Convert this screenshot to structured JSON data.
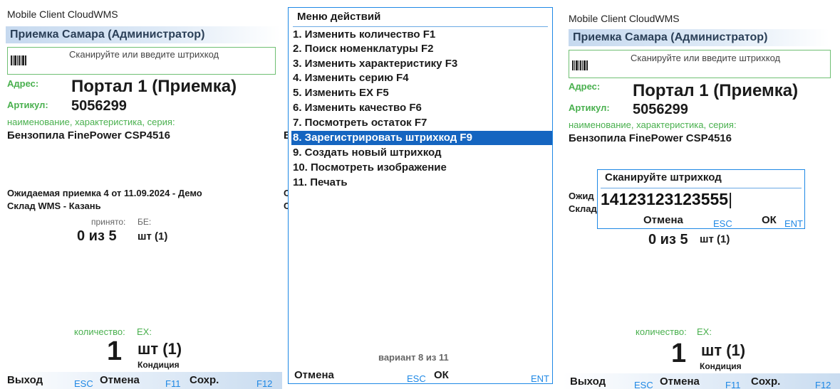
{
  "panel1": {
    "window_title": "Mobile Client CloudWMS",
    "header": "Приемка Самара (Администратор)",
    "scan_placeholder": "Сканируйте или введите штрихкод",
    "address_label": "Адрес:",
    "address_value": "Портал 1 (Приемка)",
    "article_label": "Артикул:",
    "article_value": "5056299",
    "fields_hint": "наименование,  характеристика,  серия:",
    "product_name": "Бензопила FinePower CSP4516",
    "expected_line1": "Ожидаемая приемка 4 от 11.09.2024 - Демо",
    "expected_line2": "Склад WMS - Казань",
    "accepted_label": "принято:",
    "be_label": "БЕ:",
    "accepted_value": "0 из 5",
    "unit": "шт (1)",
    "qty_label": "количество:",
    "ex_label": "ЕХ:",
    "qty_value": "1",
    "qty_unit": "шт (1)",
    "condition": "Кондиция",
    "footer": {
      "exit": "Выход",
      "exit_key": "ESC",
      "cancel": "Отмена",
      "cancel_key": "F11",
      "save": "Сохр.",
      "save_key": "F12"
    }
  },
  "panel2": {
    "menu_title": "Меню действий",
    "items": [
      "1. Изменить количество F1",
      "2. Поиск номенклатуры F2",
      "3. Изменить характеристику F3",
      "4. Изменить серию F4",
      "5. Изменить ЕХ F5",
      "6. Изменить качество F6",
      "7. Посмотреть остаток F7",
      "8. Зарегистрировать штрихкод F9",
      "9. Создать новый штрихкод",
      "10. Посмотреть изображение",
      "11. Печать"
    ],
    "selected_index": 7,
    "variant": "вариант  8 из 11",
    "cancel": "Отмена",
    "cancel_key": "ESC",
    "ok": "ОК",
    "ok_key": "ENT"
  },
  "panel3": {
    "window_title": "Mobile Client CloudWMS",
    "header": "Приемка Самара (Администратор)",
    "scan_placeholder": "Сканируйте или введите штрихкод",
    "address_label": "Адрес:",
    "address_value": "Портал 1 (Приемка)",
    "article_label": "Артикул:",
    "article_value": "5056299",
    "fields_hint": "наименование,  характеристика,  серия:",
    "product_name": "Бензопила FinePower CSP4516",
    "expected_frag1": "Ожид",
    "expected_frag2": "Склад",
    "accepted_value": "0 из 5",
    "unit": "шт (1)",
    "dialog": {
      "title": "Сканируйте штрихкод",
      "value": "14123123123555",
      "cancel": "Отмена",
      "cancel_key": "ESC",
      "ok": "ОК",
      "ok_key": "ENT"
    },
    "qty_label": "количество:",
    "ex_label": "ЕХ:",
    "qty_value": "1",
    "qty_unit": "шт (1)",
    "condition": "Кондиция",
    "footer": {
      "exit": "Выход",
      "exit_key": "ESC",
      "cancel": "Отмена",
      "cancel_key": "F11",
      "save": "Сохр.",
      "save_key": "F12"
    }
  },
  "behind": {
    "f_text": "Б",
    "o_text": "О",
    "c_text": "С"
  }
}
